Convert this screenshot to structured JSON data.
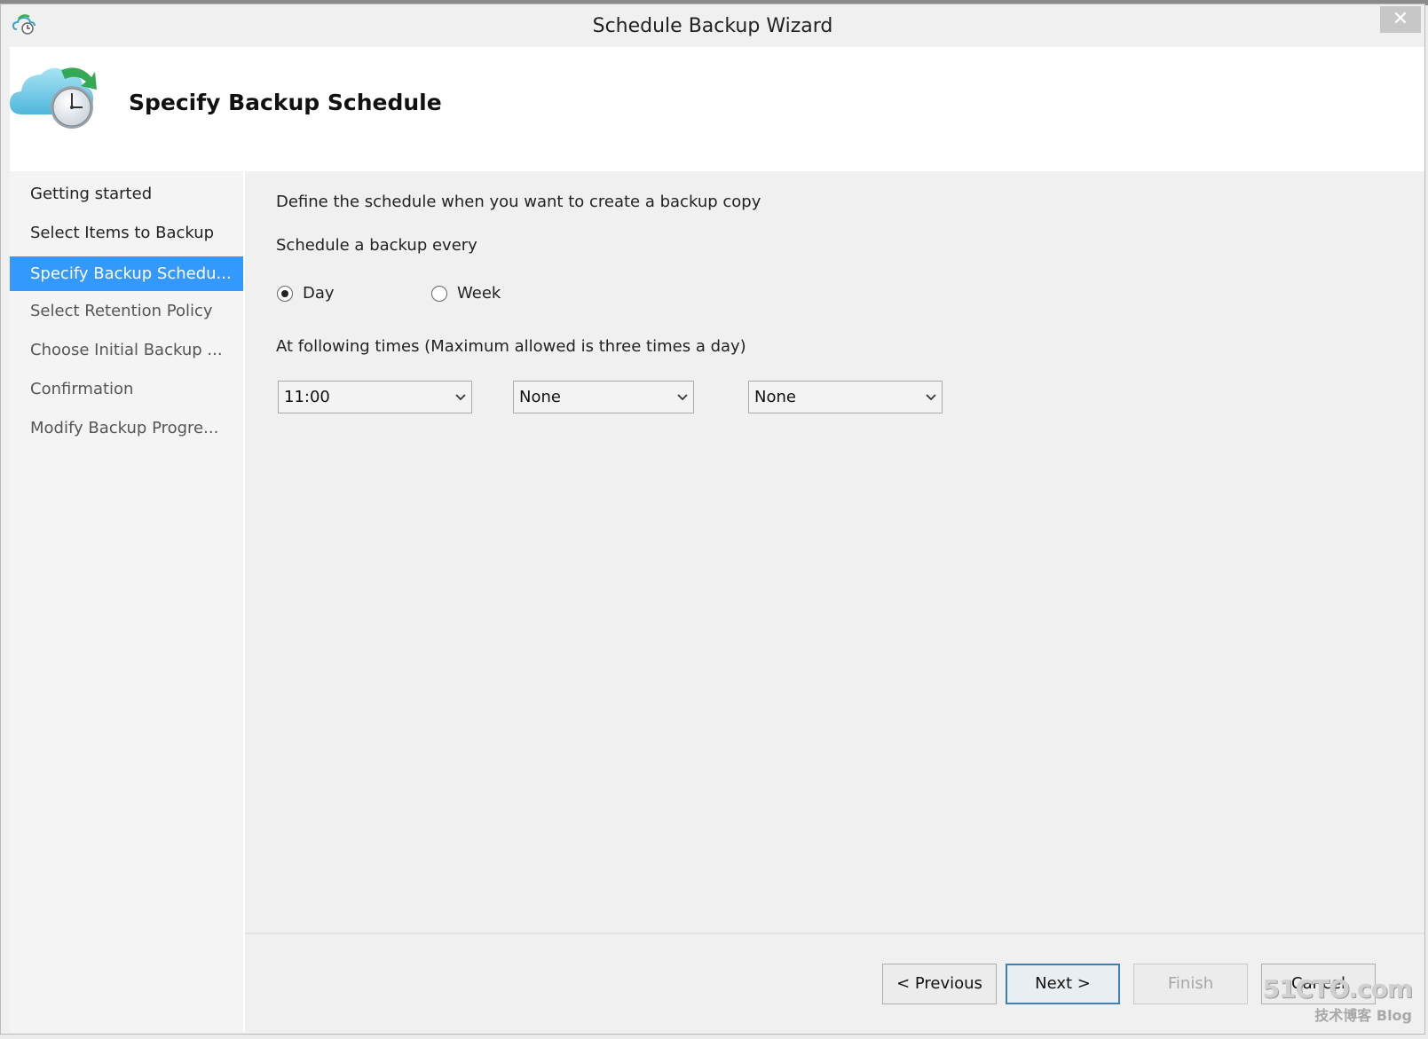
{
  "window": {
    "title": "Schedule Backup Wizard",
    "close_label": "✕"
  },
  "header": {
    "title": "Specify Backup Schedule"
  },
  "sidebar": {
    "items": [
      {
        "label": "Getting started"
      },
      {
        "label": "Select Items to Backup"
      },
      {
        "label": "Specify Backup Schedu..."
      },
      {
        "label": "Select Retention Policy"
      },
      {
        "label": "Choose Initial Backup ..."
      },
      {
        "label": "Confirmation"
      },
      {
        "label": "Modify Backup Progre..."
      }
    ],
    "active_index": 2
  },
  "main": {
    "intro": "Define the schedule when you want to create a backup copy",
    "frequency_label": "Schedule a backup every",
    "frequency_options": [
      {
        "label": "Day",
        "selected": true
      },
      {
        "label": "Week",
        "selected": false
      }
    ],
    "times_label": "At following times (Maximum allowed is three times a day)",
    "times": [
      "11:00",
      "None",
      "None"
    ]
  },
  "buttons": {
    "previous": "< Previous",
    "next": "Next >",
    "finish": "Finish",
    "cancel": "Cancel"
  },
  "watermark": {
    "line1": "51CTO.com",
    "line2": "技术博客  Blog"
  },
  "colors": {
    "accent": "#3399ff",
    "primary_border": "#3c7fb1"
  }
}
